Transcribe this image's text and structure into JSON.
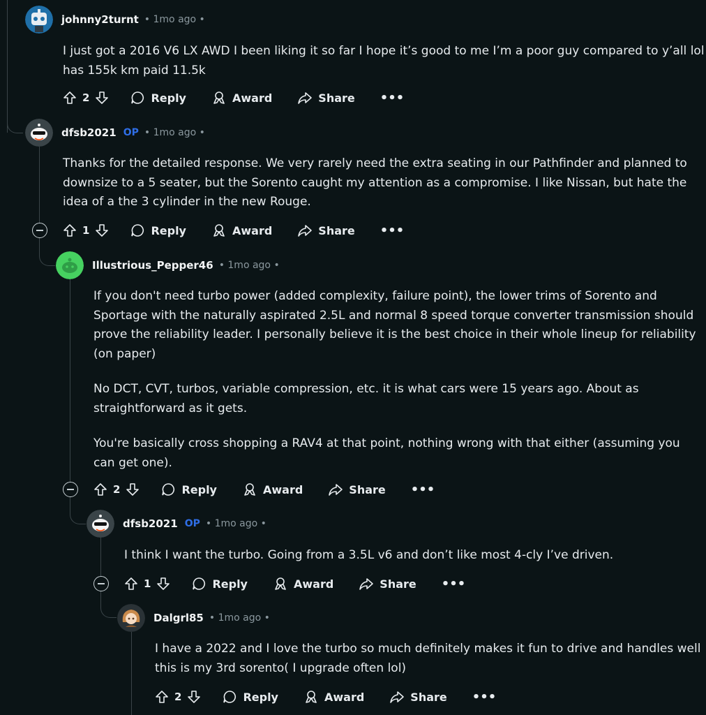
{
  "comments": [
    {
      "username": "johnny2turnt",
      "op": "",
      "meta": "• 1mo ago •",
      "body": [
        "I just got a 2016 V6 LX AWD I been liking it so far I hope it’s good to me I’m a poor guy compared to y’all lol has 155k km paid 11.5k"
      ],
      "votes": "2",
      "avatar_icon": "robot-avatar-icon"
    },
    {
      "username": "dfsb2021",
      "op": "OP",
      "meta": "• 1mo ago •",
      "body": [
        "Thanks for the detailed response. We very rarely need the extra seating in our Pathfinder and planned to downsize to a 5 seater, but the Sorento caught my attention as a compromise. I like Nissan, but hate the idea of a the 3 cylinder in the new Rouge."
      ],
      "votes": "1",
      "avatar_icon": "snoo-sunglasses-avatar-icon"
    },
    {
      "username": "Illustrious_Pepper46",
      "op": "",
      "meta": "• 1mo ago •",
      "body": [
        "If you don't need turbo power (added complexity, failure point), the lower trims of Sorento and Sportage with the naturally aspirated 2.5L and normal 8 speed torque converter transmission should prove the reliability leader. I personally believe it is the best choice in their whole lineup for reliability (on paper)",
        "No DCT, CVT, turbos, variable compression, etc. it is what cars were 15 years ago. About as straightforward as it gets.",
        "You're basically cross shopping a RAV4 at that point, nothing wrong with that either (assuming you can get one)."
      ],
      "votes": "2",
      "avatar_icon": "snoo-green-avatar-icon"
    },
    {
      "username": "dfsb2021",
      "op": "OP",
      "meta": "• 1mo ago •",
      "body": [
        "I think I want the turbo. Going from a 3.5L v6 and don’t like most 4-cly I’ve driven."
      ],
      "votes": "1",
      "avatar_icon": "snoo-sunglasses-avatar-icon"
    },
    {
      "username": "Dalgrl85",
      "op": "",
      "meta": "• 1mo ago •",
      "body": [
        "I have a 2022 and I love the turbo so much definitely makes it fun to drive and handles well this is my 3rd sorento( I upgrade often lol)"
      ],
      "votes": "2",
      "avatar_icon": "anime-girl-avatar-icon"
    }
  ],
  "actions": {
    "reply": "Reply",
    "award": "Award",
    "share": "Share",
    "more": "•••"
  },
  "colors": {
    "background": "#0b1416",
    "op_badge": "#2f6ee6",
    "thread_line": "#3a4448"
  }
}
